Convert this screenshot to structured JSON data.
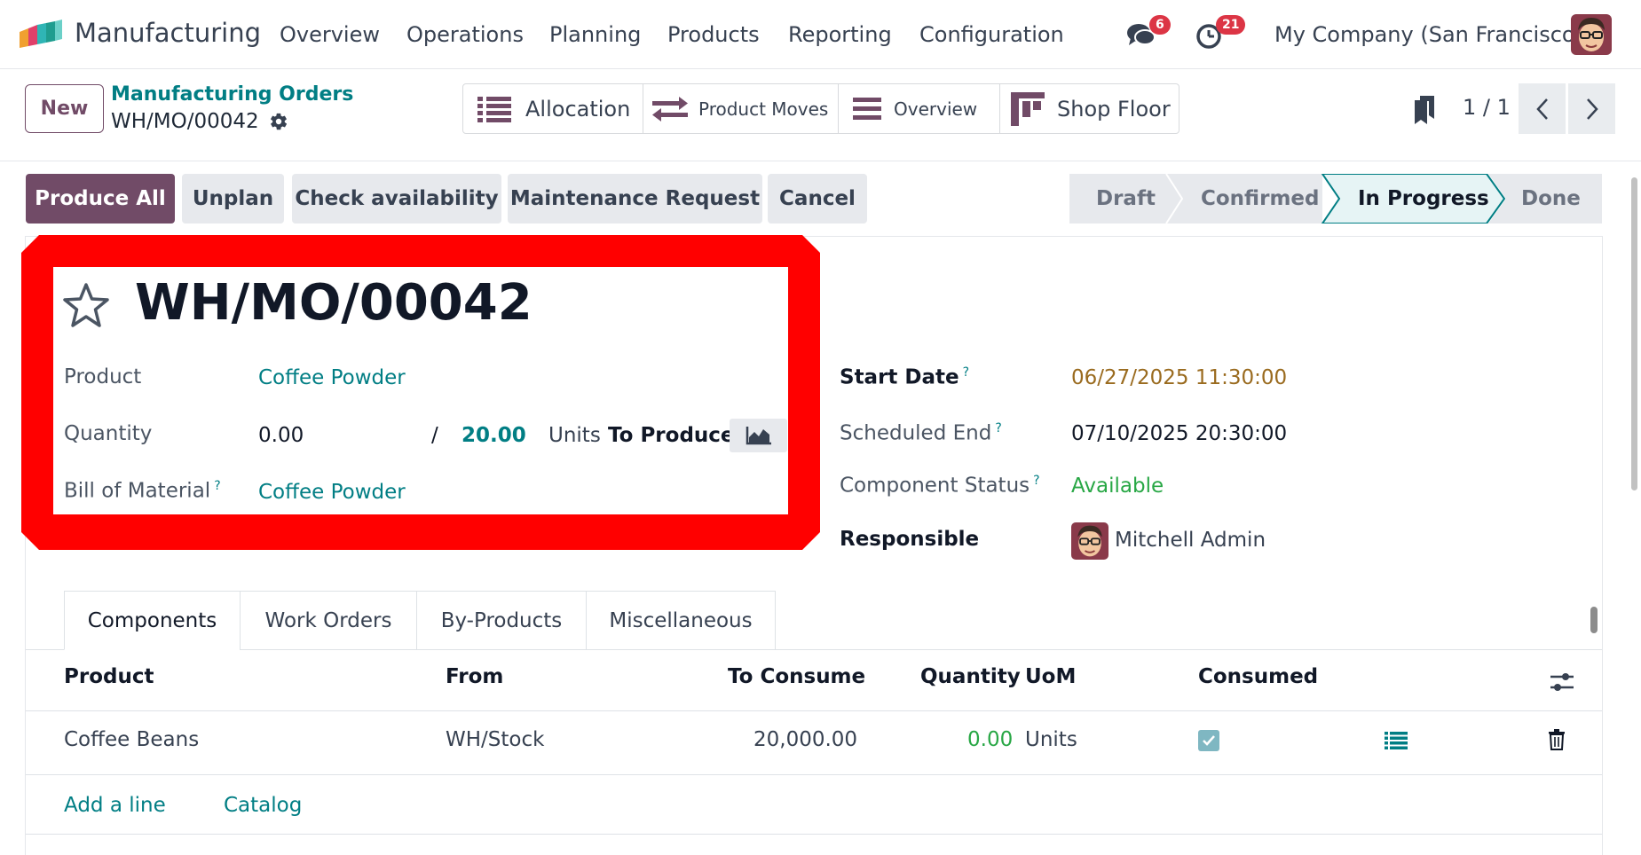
{
  "app": {
    "name": "Manufacturing",
    "menu": [
      "Overview",
      "Operations",
      "Planning",
      "Products",
      "Reporting",
      "Configuration"
    ],
    "messages_count": "6",
    "activities_count": "21",
    "company": "My Company (San Francisco)"
  },
  "control_panel": {
    "new_label": "New",
    "breadcrumb_parent": "Manufacturing Orders",
    "breadcrumb_current": "WH/MO/00042",
    "smart_buttons": [
      {
        "label": "Allocation",
        "icon": "list-icon"
      },
      {
        "label": "Product Moves",
        "icon": "exchange-icon"
      },
      {
        "label": "Overview",
        "icon": "bars-icon"
      },
      {
        "label": "Shop Floor",
        "icon": "shop-floor-icon"
      }
    ],
    "pager": "1 / 1"
  },
  "actions": {
    "produce_all": "Produce All",
    "unplan": "Unplan",
    "check_availability": "Check availability",
    "maintenance_request": "Maintenance Request",
    "cancel": "Cancel"
  },
  "statusbar": {
    "stages": [
      "Draft",
      "Confirmed",
      "In Progress",
      "Done"
    ],
    "current": "In Progress"
  },
  "form": {
    "title": "WH/MO/00042",
    "product_label": "Product",
    "product_value": "Coffee Powder",
    "quantity_label": "Quantity",
    "quantity_produced": "0.00",
    "quantity_separator": "/",
    "quantity_target": "20.00",
    "quantity_uom": "Units",
    "quantity_suffix": "To Produce",
    "bom_label": "Bill of Material",
    "bom_value": "Coffee Powder",
    "start_date_label": "Start Date",
    "start_date_value": "06/27/2025 11:30:00",
    "scheduled_end_label": "Scheduled End",
    "scheduled_end_value": "07/10/2025 20:30:00",
    "component_status_label": "Component Status",
    "component_status_value": "Available",
    "responsible_label": "Responsible",
    "responsible_value": "Mitchell Admin",
    "help_mark": "?"
  },
  "tabs": [
    "Components",
    "Work Orders",
    "By-Products",
    "Miscellaneous"
  ],
  "components_table": {
    "headers": {
      "product": "Product",
      "from": "From",
      "to_consume": "To Consume",
      "quantity": "Quantity",
      "uom": "UoM",
      "consumed": "Consumed"
    },
    "rows": [
      {
        "product": "Coffee Beans",
        "from": "WH/Stock",
        "to_consume": "20,000.00",
        "quantity": "0.00",
        "uom": "Units",
        "consumed": true
      }
    ],
    "add_line": "Add a line",
    "catalog": "Catalog"
  },
  "colors": {
    "primary": "#714b67",
    "link": "#017e84",
    "highlight_frame": "#ff0000",
    "start_date": "#9a6b1f",
    "available": "#28a745"
  }
}
